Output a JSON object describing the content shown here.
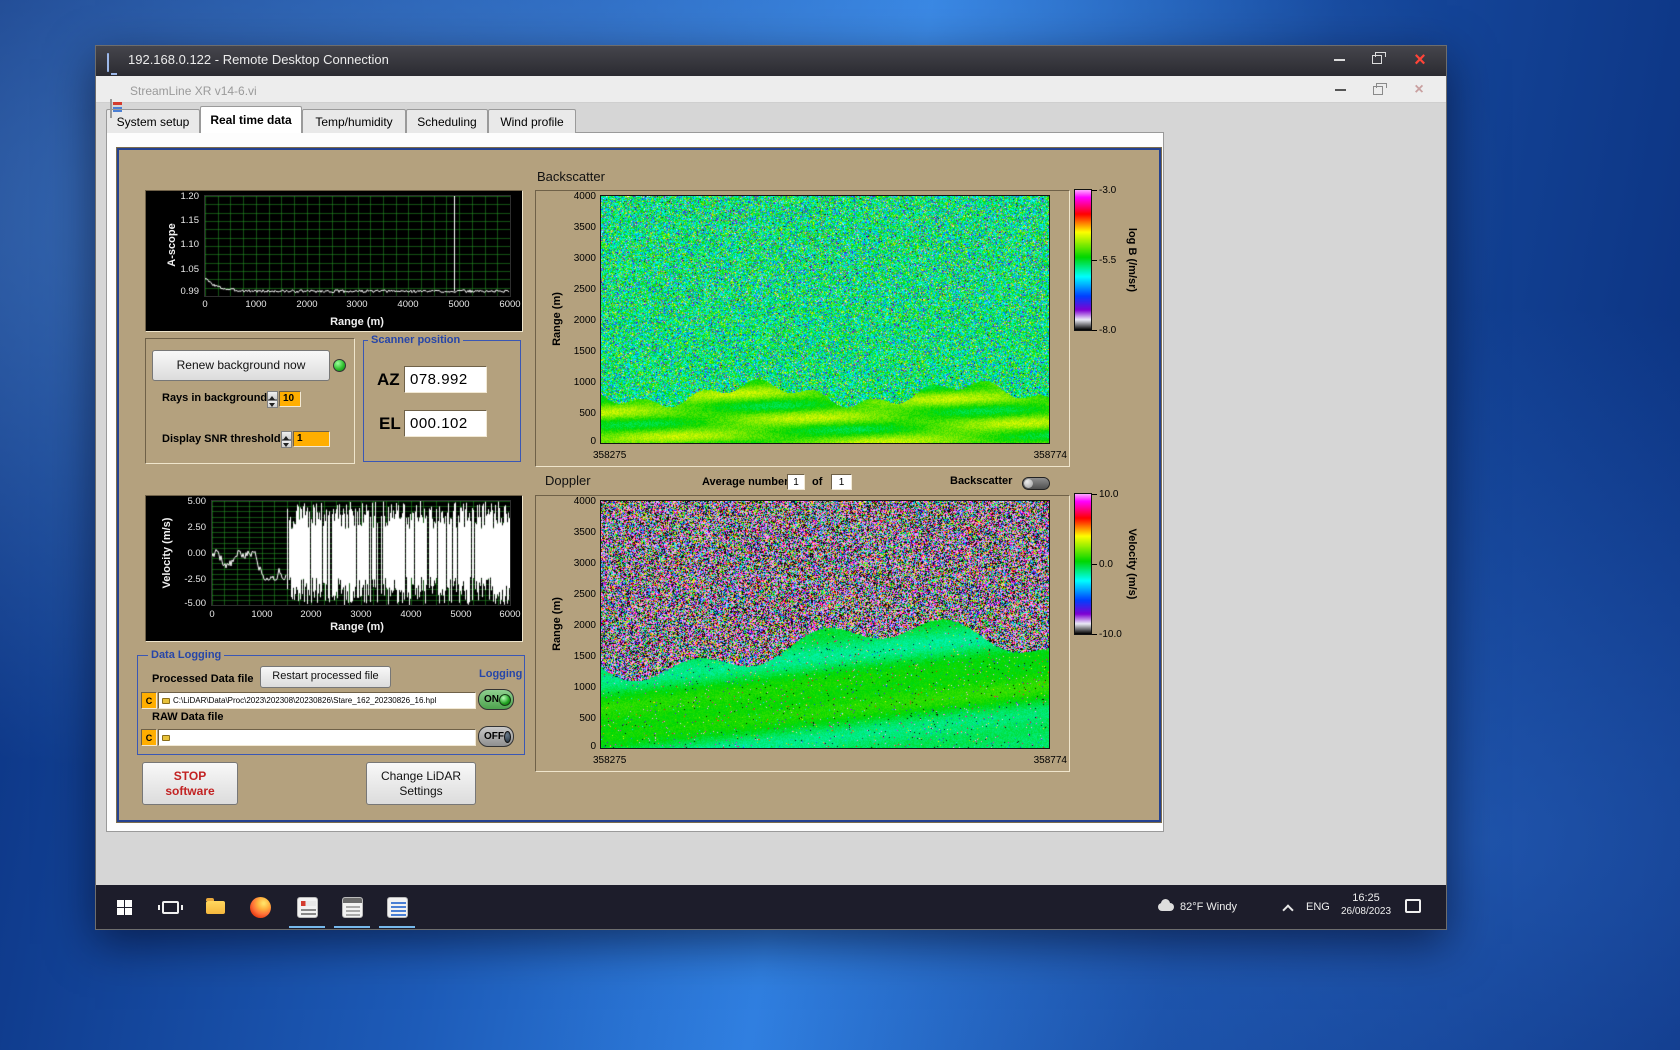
{
  "rdp": {
    "title": "192.168.0.122 - Remote Desktop Connection"
  },
  "app": {
    "title": "StreamLine XR v14-6.vi",
    "tabs": [
      {
        "label": "System setup"
      },
      {
        "label": "Real time data"
      },
      {
        "label": "Temp/humidity"
      },
      {
        "label": "Scheduling"
      },
      {
        "label": "Wind profile"
      }
    ],
    "active_tab": "Real time data"
  },
  "controls": {
    "renew_button_label": "Renew background now",
    "rays_in_background_label": "Rays in background",
    "rays_in_background_value": "10",
    "snr_threshold_label": "Display SNR threshold",
    "snr_threshold_value": "1"
  },
  "scanner_position": {
    "title": "Scanner position",
    "az_label": "AZ",
    "az_value": "078.992",
    "el_label": "EL",
    "el_value": "000.102"
  },
  "doppler_controls": {
    "average_number_label": "Average number",
    "average_number_value": "1",
    "of_label": "of",
    "of_value": "1",
    "backscatter_toggle_label": "Backscatter"
  },
  "data_logging": {
    "group_title": "Data Logging",
    "processed_file_label": "Processed Data file",
    "restart_button_label": "Restart processed file",
    "processed_file_drive": "C",
    "processed_file_path": "C:\\LiDAR\\Data\\Proc\\2023\\202308\\20230826\\Stare_162_20230826_16.hpl",
    "raw_file_label": "RAW Data file",
    "raw_file_drive": "C",
    "raw_file_path": "",
    "logging_label": "Logging",
    "processed_logging_state": "ON",
    "raw_logging_state": "OFF"
  },
  "footer_buttons": {
    "stop_line1": "STOP",
    "stop_line2": "software",
    "change_settings_line1": "Change LiDAR",
    "change_settings_line2": "Settings"
  },
  "taskbar": {
    "weather": "82°F Windy",
    "language": "ENG",
    "time": "16:25",
    "date": "26/08/2023"
  },
  "colors": {
    "panel_tan": "#b4a17e",
    "group_blue": "#2746a8",
    "field_orange": "#ffae00",
    "led_green": "#2fbf2f",
    "stop_red": "#c22222"
  },
  "chart_data": [
    {
      "id": "ascope",
      "type": "line",
      "ylabel": "A-scope",
      "xlabel": "Range (m)",
      "ylim": [
        0.99,
        1.2
      ],
      "ytick_labels": [
        "1.20",
        "1.15",
        "1.10",
        "1.05",
        "0.99"
      ],
      "xlim": [
        0,
        6000
      ],
      "xtick_labels": [
        "0",
        "1000",
        "2000",
        "3000",
        "4000",
        "5000",
        "6000"
      ],
      "grid": true,
      "series": [
        {
          "name": "a-scope",
          "baseline": 1.0,
          "start_value": 1.03,
          "spike_x_m": 4900,
          "spike_peak": 1.2,
          "summary": "white trace decays from ~1.03 to flat ~1.00 with small noise; single narrow spike to 1.20 near 4900 m"
        }
      ]
    },
    {
      "id": "backscatter",
      "type": "heatmap",
      "title": "Backscatter",
      "ylabel": "Range (m)",
      "ytick_labels": [
        "4000",
        "3500",
        "3000",
        "2500",
        "2000",
        "1500",
        "1000",
        "500",
        "0"
      ],
      "xtick_labels": [
        "358275",
        "358774"
      ],
      "vmax": -3.0,
      "vmin": -8.0,
      "colorbar": {
        "label": "log B (/m/sr)",
        "tick_labels": [
          "-3.0",
          "-5.5",
          "-8.0"
        ]
      },
      "summary": "speckled green/cyan/blue noise around -5.5 above ~1000 m; smooth bright green layer (~-5) with faint wave bands below ~800 m"
    },
    {
      "id": "velocity",
      "type": "line",
      "ylabel": "Velocity (m/s)",
      "xlabel": "Range (m)",
      "ylim": [
        -5,
        5
      ],
      "ytick_labels": [
        "5.00",
        "2.50",
        "0.00",
        "-2.50",
        "-5.00"
      ],
      "xlim": [
        0,
        6000
      ],
      "xtick_labels": [
        "0",
        "1000",
        "2000",
        "3000",
        "4000",
        "5000",
        "6000"
      ],
      "grid": true,
      "series": [
        {
          "name": "velocity",
          "coherent_until_m": 1500,
          "summary": "coherent trace within ±2 m/s below ~1500 m, saturated random vertical noise spanning full scale beyond"
        }
      ]
    },
    {
      "id": "doppler",
      "type": "heatmap",
      "title": "Doppler",
      "ylabel": "Range (m)",
      "ytick_labels": [
        "4000",
        "3500",
        "3000",
        "2500",
        "2000",
        "1500",
        "1000",
        "500",
        "0"
      ],
      "xtick_labels": [
        "358275",
        "358774"
      ],
      "vmax": 10.0,
      "vmin": -10.0,
      "colorbar": {
        "label": "Velocity (m/s)",
        "tick_labels": [
          "10.0",
          "0.0",
          "-10.0"
        ]
      },
      "summary": "random magenta/purple/black velocity noise above a wavy ~1400 m boundary; smooth near-zero green velocities with diagonal wave bands below"
    }
  ]
}
